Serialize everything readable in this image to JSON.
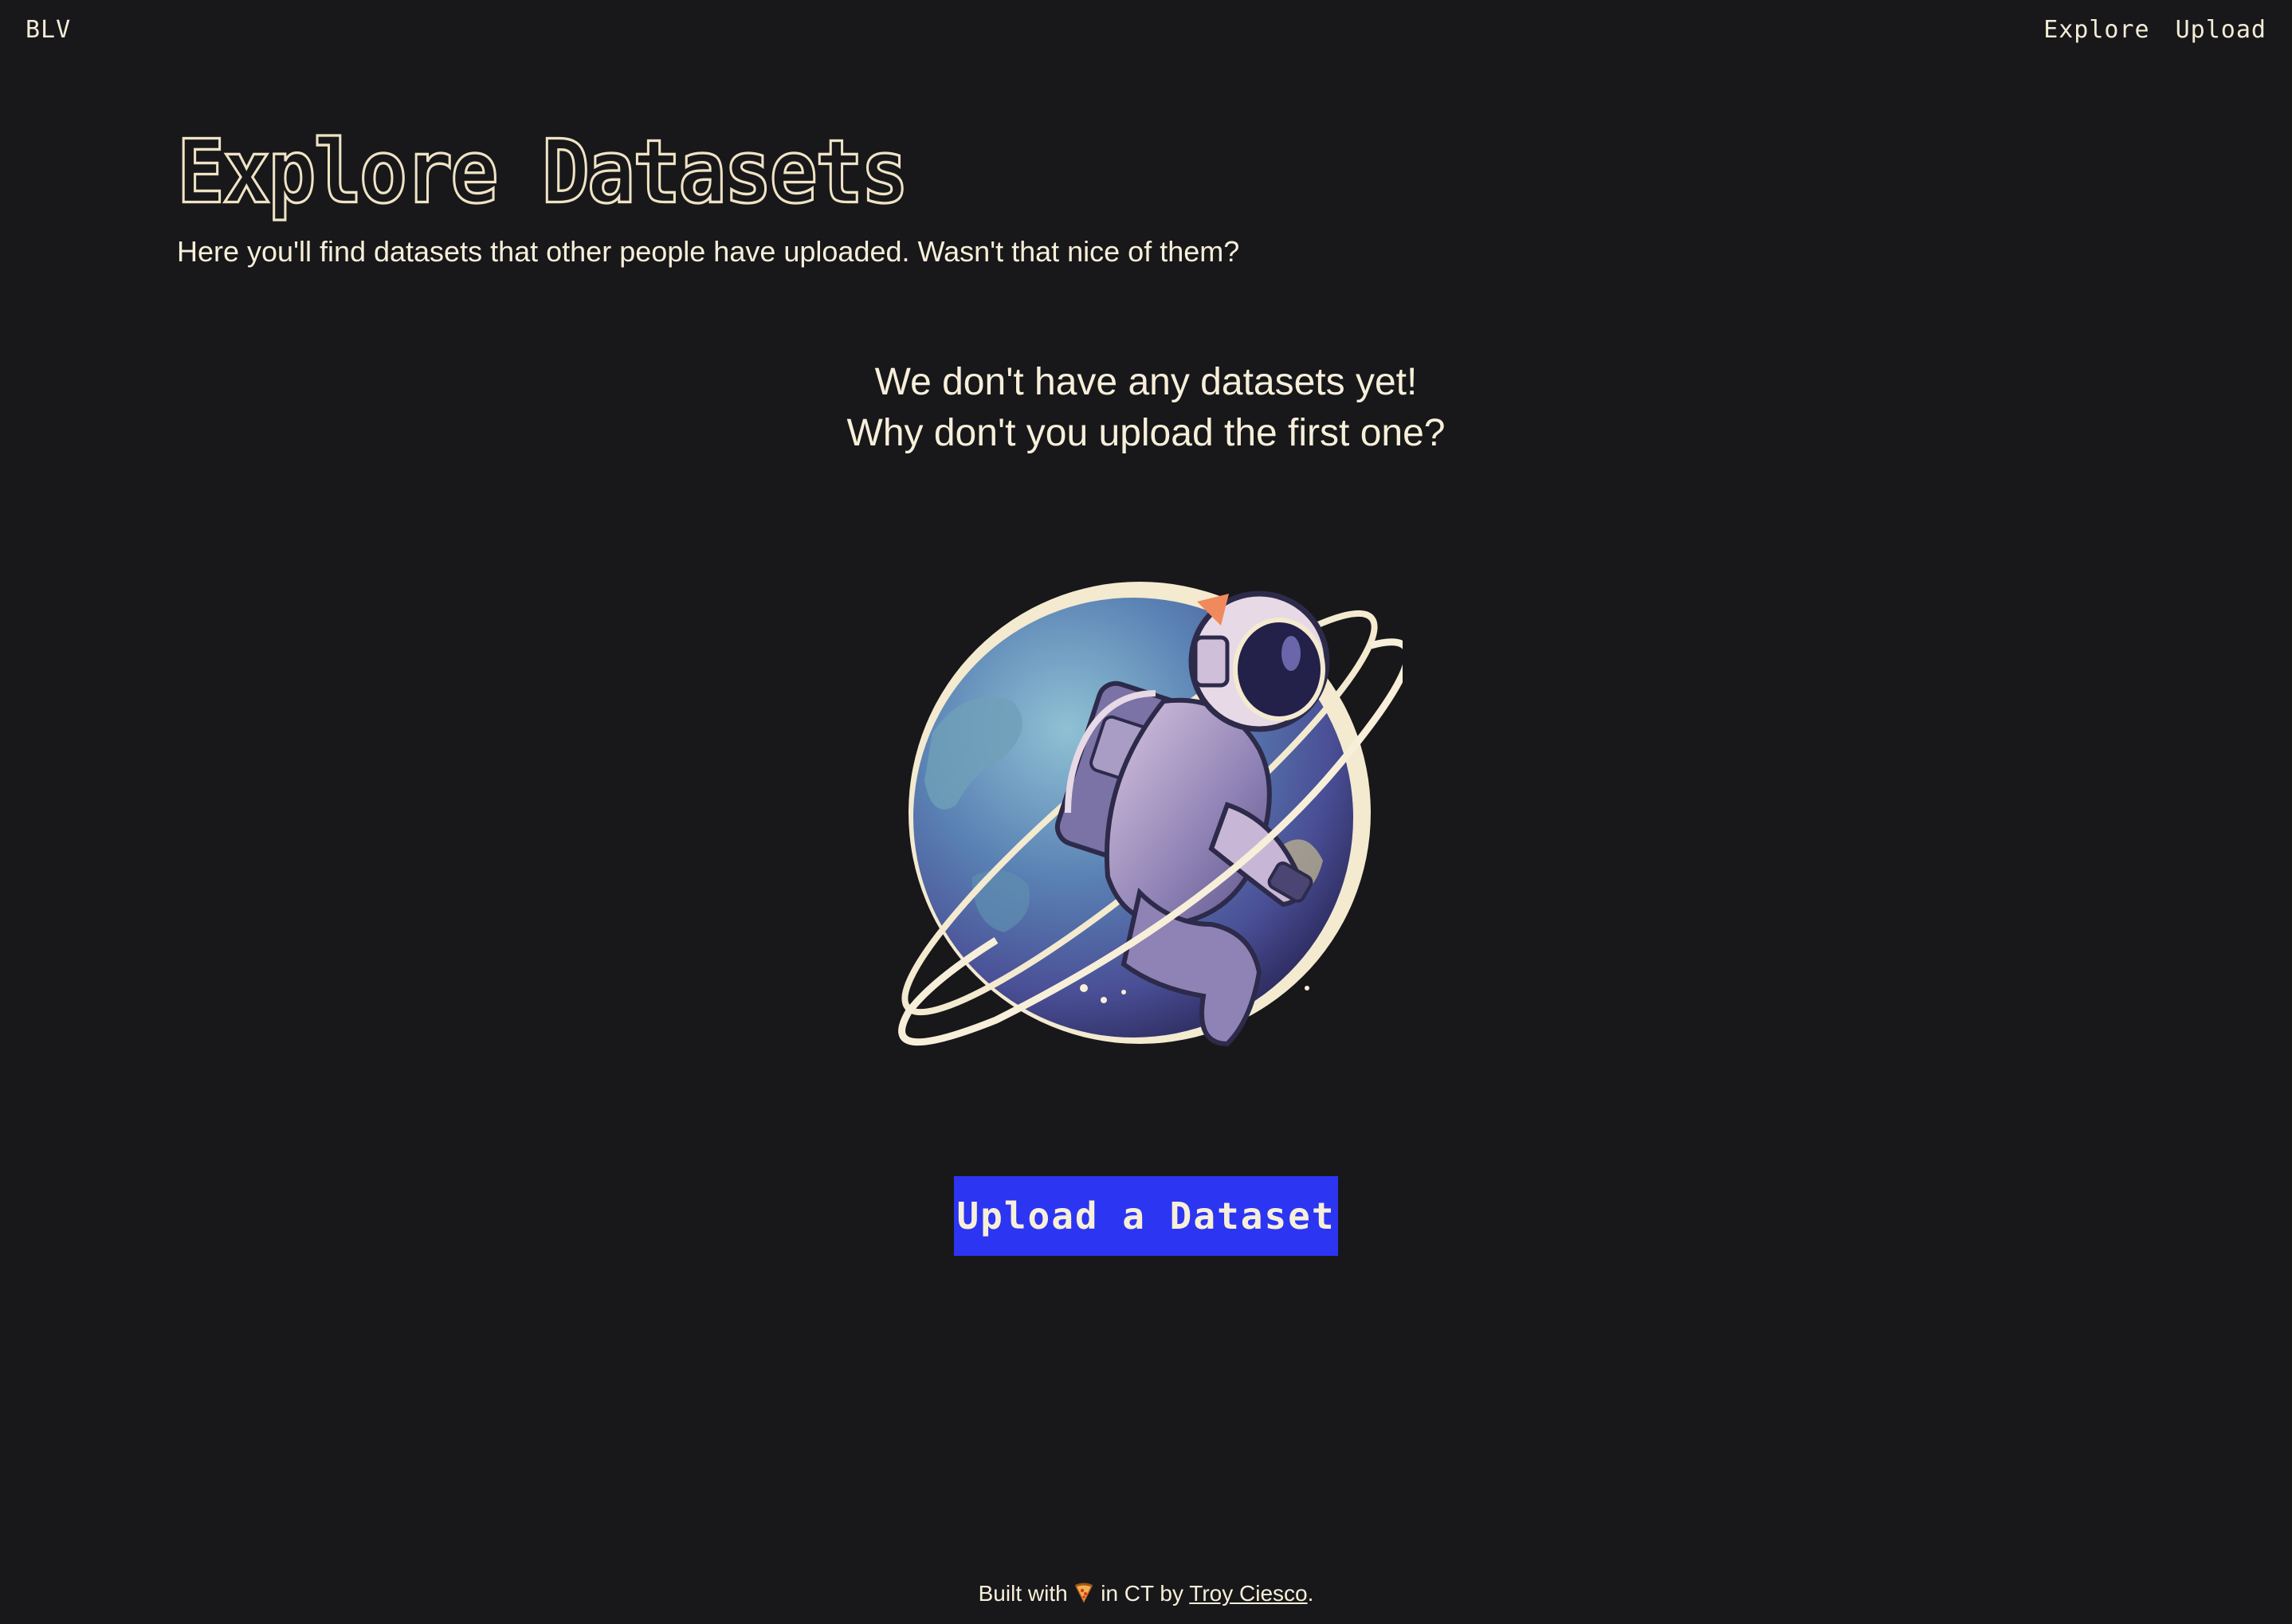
{
  "nav": {
    "brand": "BLV",
    "links": [
      {
        "label": "Explore"
      },
      {
        "label": "Upload"
      }
    ]
  },
  "main": {
    "title": "Explore Datasets",
    "description": "Here you'll find datasets that other people have uploaded. Wasn't that nice of them?",
    "empty_state": {
      "line1": "We don't have any datasets yet!",
      "line2": "Why don't you upload the first one?",
      "illustration_icon": "astronaut-planet-illustration"
    },
    "cta_label": "Upload a Dataset"
  },
  "footer": {
    "prefix": "Built with",
    "icon": "pizza-icon",
    "middle": "in CT by",
    "author": "Troy Ciesco",
    "suffix": "."
  },
  "colors": {
    "background": "#18181b",
    "text": "#f7efd9",
    "accent": "#2b35f2"
  }
}
